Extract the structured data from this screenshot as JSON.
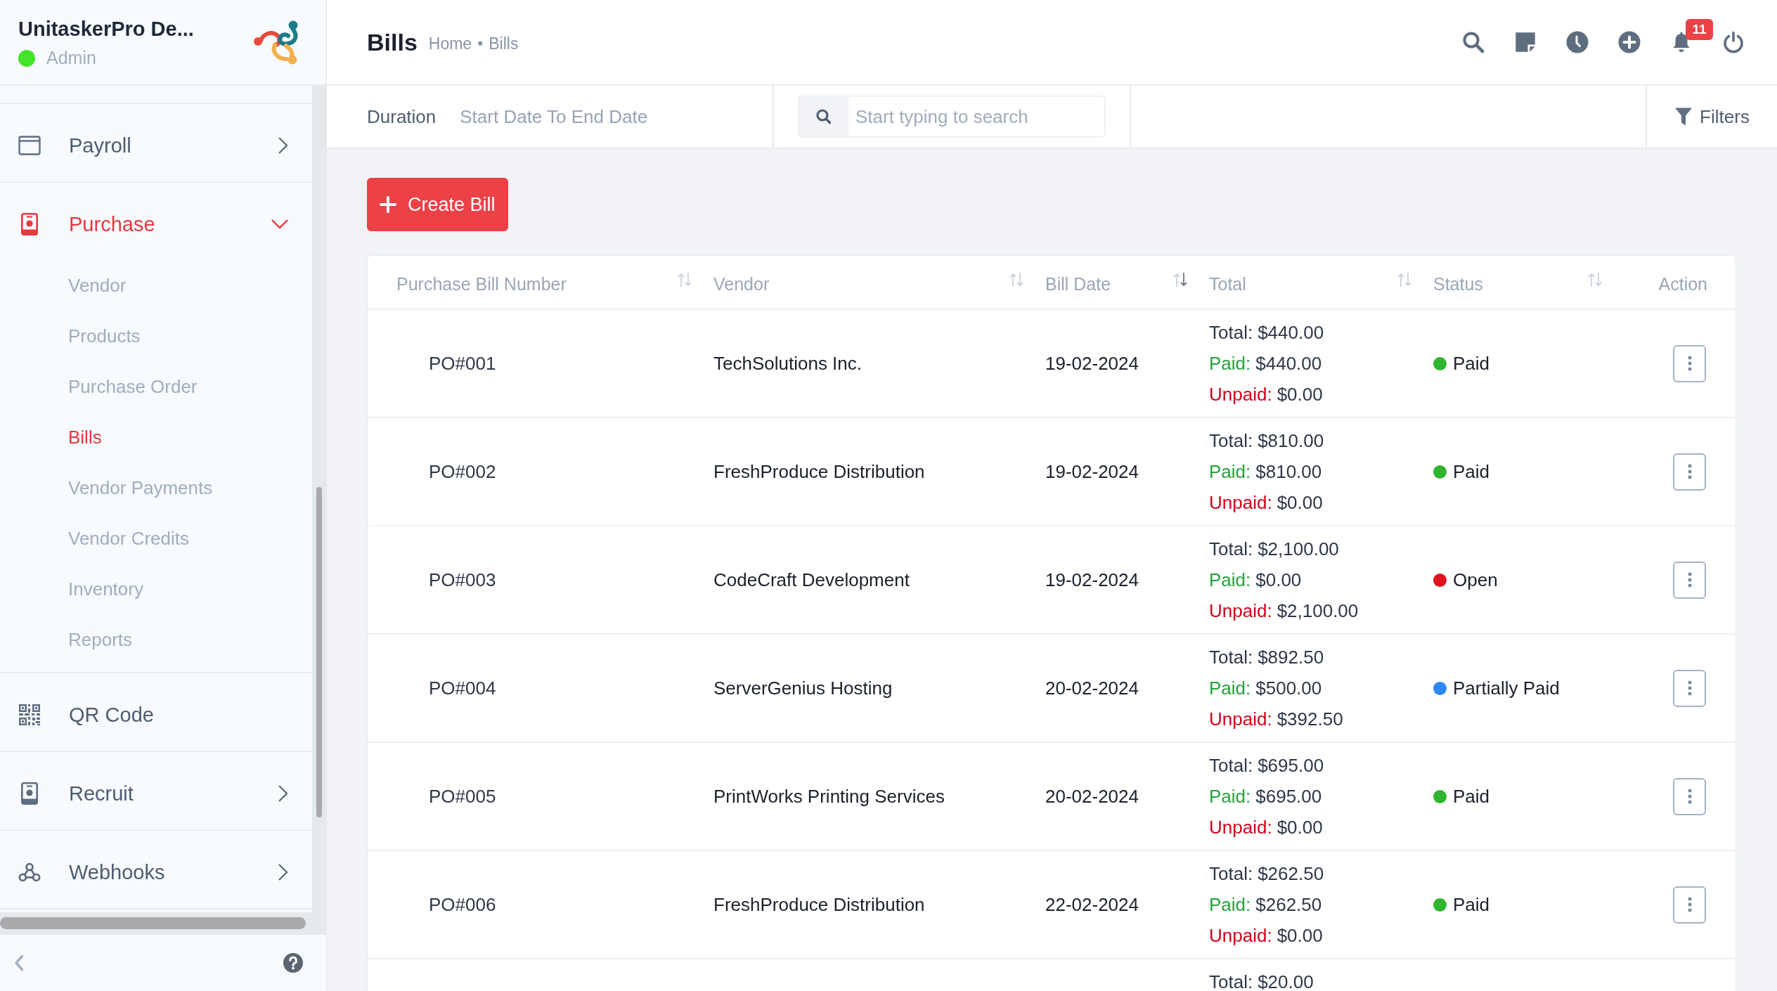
{
  "sidebar": {
    "brand": {
      "title": "UnitaskerPro De...",
      "role": "Admin",
      "online": true
    },
    "nav": [
      {
        "label": "Payroll",
        "selected": false,
        "expanded": false
      },
      {
        "label": "Purchase",
        "selected": true,
        "expanded": true,
        "children": [
          {
            "label": "Vendor",
            "selected": false
          },
          {
            "label": "Products",
            "selected": false
          },
          {
            "label": "Purchase Order",
            "selected": false
          },
          {
            "label": "Bills",
            "selected": true
          },
          {
            "label": "Vendor Payments",
            "selected": false
          },
          {
            "label": "Vendor Credits",
            "selected": false
          },
          {
            "label": "Inventory",
            "selected": false
          },
          {
            "label": "Reports",
            "selected": false
          }
        ]
      },
      {
        "label": "QR Code",
        "selected": false
      },
      {
        "label": "Recruit",
        "selected": false,
        "expanded": false
      },
      {
        "label": "Webhooks",
        "selected": false,
        "expanded": false
      }
    ]
  },
  "header": {
    "title": "Bills",
    "breadcrumb": {
      "items": [
        "Home",
        "Bills"
      ],
      "separator": "•"
    },
    "notification_count": "11"
  },
  "filter_bar": {
    "duration_label": "Duration",
    "date_range": {
      "placeholder": "Start Date To End Date"
    },
    "search": {
      "placeholder": "Start typing to search"
    },
    "filters_button": "Filters"
  },
  "create_button": "Create Bill",
  "table": {
    "columns": [
      {
        "label": "Purchase Bill Number",
        "sorted": false
      },
      {
        "label": "Vendor",
        "sorted": false
      },
      {
        "label": "Bill Date",
        "sorted": true
      },
      {
        "label": "Total",
        "sorted": false
      },
      {
        "label": "Status",
        "sorted": false
      },
      {
        "label": "Action"
      }
    ],
    "rows": [
      {
        "number": "PO#001",
        "vendor": "TechSolutions Inc.",
        "date": "19-02-2024",
        "amounts": [
          {
            "kind": "total",
            "label": "Total:",
            "value": "$440.00"
          },
          {
            "kind": "paid",
            "label": "Paid:",
            "value": "$440.00"
          },
          {
            "kind": "unpaid",
            "label": "Unpaid:",
            "value": "$0.00"
          }
        ],
        "status": {
          "label": "Paid",
          "color": "#2fb52f"
        },
        "actions_menu": true
      },
      {
        "number": "PO#002",
        "vendor": "FreshProduce Distribution",
        "date": "19-02-2024",
        "amounts": [
          {
            "kind": "total",
            "label": "Total:",
            "value": "$810.00"
          },
          {
            "kind": "paid",
            "label": "Paid:",
            "value": "$810.00"
          },
          {
            "kind": "unpaid",
            "label": "Unpaid:",
            "value": "$0.00"
          }
        ],
        "status": {
          "label": "Paid",
          "color": "#2fb52f"
        },
        "actions_menu": true
      },
      {
        "number": "PO#003",
        "vendor": "CodeCraft Development",
        "date": "19-02-2024",
        "amounts": [
          {
            "kind": "total",
            "label": "Total:",
            "value": "$2,100.00"
          },
          {
            "kind": "paid",
            "label": "Paid:",
            "value": "$0.00"
          },
          {
            "kind": "unpaid",
            "label": "Unpaid:",
            "value": "$2,100.00"
          }
        ],
        "status": {
          "label": "Open",
          "color": "#e0141e"
        },
        "actions_menu": true
      },
      {
        "number": "PO#004",
        "vendor": "ServerGenius Hosting",
        "date": "20-02-2024",
        "amounts": [
          {
            "kind": "total",
            "label": "Total:",
            "value": "$892.50"
          },
          {
            "kind": "paid",
            "label": "Paid:",
            "value": "$500.00"
          },
          {
            "kind": "unpaid",
            "label": "Unpaid:",
            "value": "$392.50"
          }
        ],
        "status": {
          "label": "Partially Paid",
          "color": "#2f86f6"
        },
        "actions_menu": true
      },
      {
        "number": "PO#005",
        "vendor": "PrintWorks Printing Services",
        "date": "20-02-2024",
        "amounts": [
          {
            "kind": "total",
            "label": "Total:",
            "value": "$695.00"
          },
          {
            "kind": "paid",
            "label": "Paid:",
            "value": "$695.00"
          },
          {
            "kind": "unpaid",
            "label": "Unpaid:",
            "value": "$0.00"
          }
        ],
        "status": {
          "label": "Paid",
          "color": "#2fb52f"
        },
        "actions_menu": true
      },
      {
        "number": "PO#006",
        "vendor": "FreshProduce Distribution",
        "date": "22-02-2024",
        "amounts": [
          {
            "kind": "total",
            "label": "Total:",
            "value": "$262.50"
          },
          {
            "kind": "paid",
            "label": "Paid:",
            "value": "$262.50"
          },
          {
            "kind": "unpaid",
            "label": "Unpaid:",
            "value": "$0.00"
          }
        ],
        "status": {
          "label": "Paid",
          "color": "#2fb52f"
        },
        "actions_menu": true
      },
      {
        "amounts": [
          {
            "kind": "total",
            "label": "Total:",
            "value": "$20.00"
          }
        ]
      }
    ]
  }
}
